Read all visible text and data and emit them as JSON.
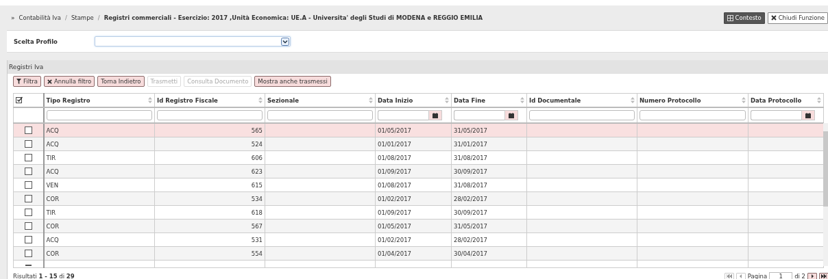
{
  "breadcrumb": {
    "marker": "»",
    "separator": "/",
    "items": [
      "Contabilità Iva",
      "Stampe",
      "Registri commerciali - Esercizio: 2017 ,Unità Economica: UE.A - Universita' degli Studi di MODENA e REGGIO EMILIA"
    ]
  },
  "header_buttons": [
    {
      "label": "Contesto",
      "kind": "dark"
    },
    {
      "label": "Chiudi Funzione",
      "kind": "light"
    }
  ],
  "profile": {
    "label": "Scelta Profilo"
  },
  "panel": {
    "title": "Registri Iva"
  },
  "toolbar": [
    {
      "label": "Filtra",
      "kind": "filter",
      "disabled": false
    },
    {
      "label": "Annulla filtro",
      "kind": "clear",
      "disabled": false
    },
    {
      "label": "Torna Indietro",
      "disabled": false
    },
    {
      "label": "Trasmetti",
      "disabled": true
    },
    {
      "label": "Consulta Documento",
      "disabled": true
    },
    {
      "label": "Mostra anche trasmessi",
      "disabled": false
    }
  ],
  "table": {
    "columns": [
      {
        "label": "Tipo Registro",
        "kind": "text"
      },
      {
        "label": "Id Registro Fiscale",
        "kind": "number"
      },
      {
        "label": "Sezionale",
        "kind": "text"
      },
      {
        "label": "Data Inizio",
        "kind": "date"
      },
      {
        "label": "Data Fine",
        "kind": "date"
      },
      {
        "label": "Id Documentale",
        "kind": "text"
      },
      {
        "label": "Numero Protocollo",
        "kind": "text"
      },
      {
        "label": "Data Protocollo",
        "kind": "date"
      }
    ],
    "rows": [
      {
        "selected": true,
        "checked": false,
        "cells": [
          "ACQ",
          "565",
          "",
          "01/05/2017",
          "31/05/2017",
          "",
          "",
          ""
        ]
      },
      {
        "selected": false,
        "checked": false,
        "cells": [
          "ACQ",
          "524",
          "",
          "01/01/2017",
          "31/01/2017",
          "",
          "",
          ""
        ]
      },
      {
        "selected": false,
        "checked": false,
        "cells": [
          "TIR",
          "606",
          "",
          "01/08/2017",
          "31/08/2017",
          "",
          "",
          ""
        ]
      },
      {
        "selected": false,
        "checked": false,
        "cells": [
          "ACQ",
          "623",
          "",
          "01/09/2017",
          "30/09/2017",
          "",
          "",
          ""
        ]
      },
      {
        "selected": false,
        "checked": false,
        "cells": [
          "VEN",
          "615",
          "",
          "01/08/2017",
          "31/08/2017",
          "",
          "",
          ""
        ]
      },
      {
        "selected": false,
        "checked": false,
        "cells": [
          "COR",
          "534",
          "",
          "01/02/2017",
          "28/02/2017",
          "",
          "",
          ""
        ]
      },
      {
        "selected": false,
        "checked": false,
        "cells": [
          "TIR",
          "618",
          "",
          "01/09/2017",
          "30/09/2017",
          "",
          "",
          ""
        ]
      },
      {
        "selected": false,
        "checked": false,
        "cells": [
          "COR",
          "567",
          "",
          "01/05/2017",
          "31/05/2017",
          "",
          "",
          ""
        ]
      },
      {
        "selected": false,
        "checked": false,
        "cells": [
          "ACQ",
          "531",
          "",
          "01/02/2017",
          "28/02/2017",
          "",
          "",
          ""
        ]
      },
      {
        "selected": false,
        "checked": false,
        "cells": [
          "COR",
          "554",
          "",
          "01/04/2017",
          "30/04/2017",
          "",
          "",
          ""
        ]
      }
    ]
  },
  "footer": {
    "results": "Risultati **1 - 15** di **29**",
    "pager": {
      "first_disabled": true,
      "prev_disabled": true,
      "next_disabled": false,
      "last_disabled": false,
      "page_label": "Pagina",
      "page": "1",
      "of": "di 2"
    }
  }
}
